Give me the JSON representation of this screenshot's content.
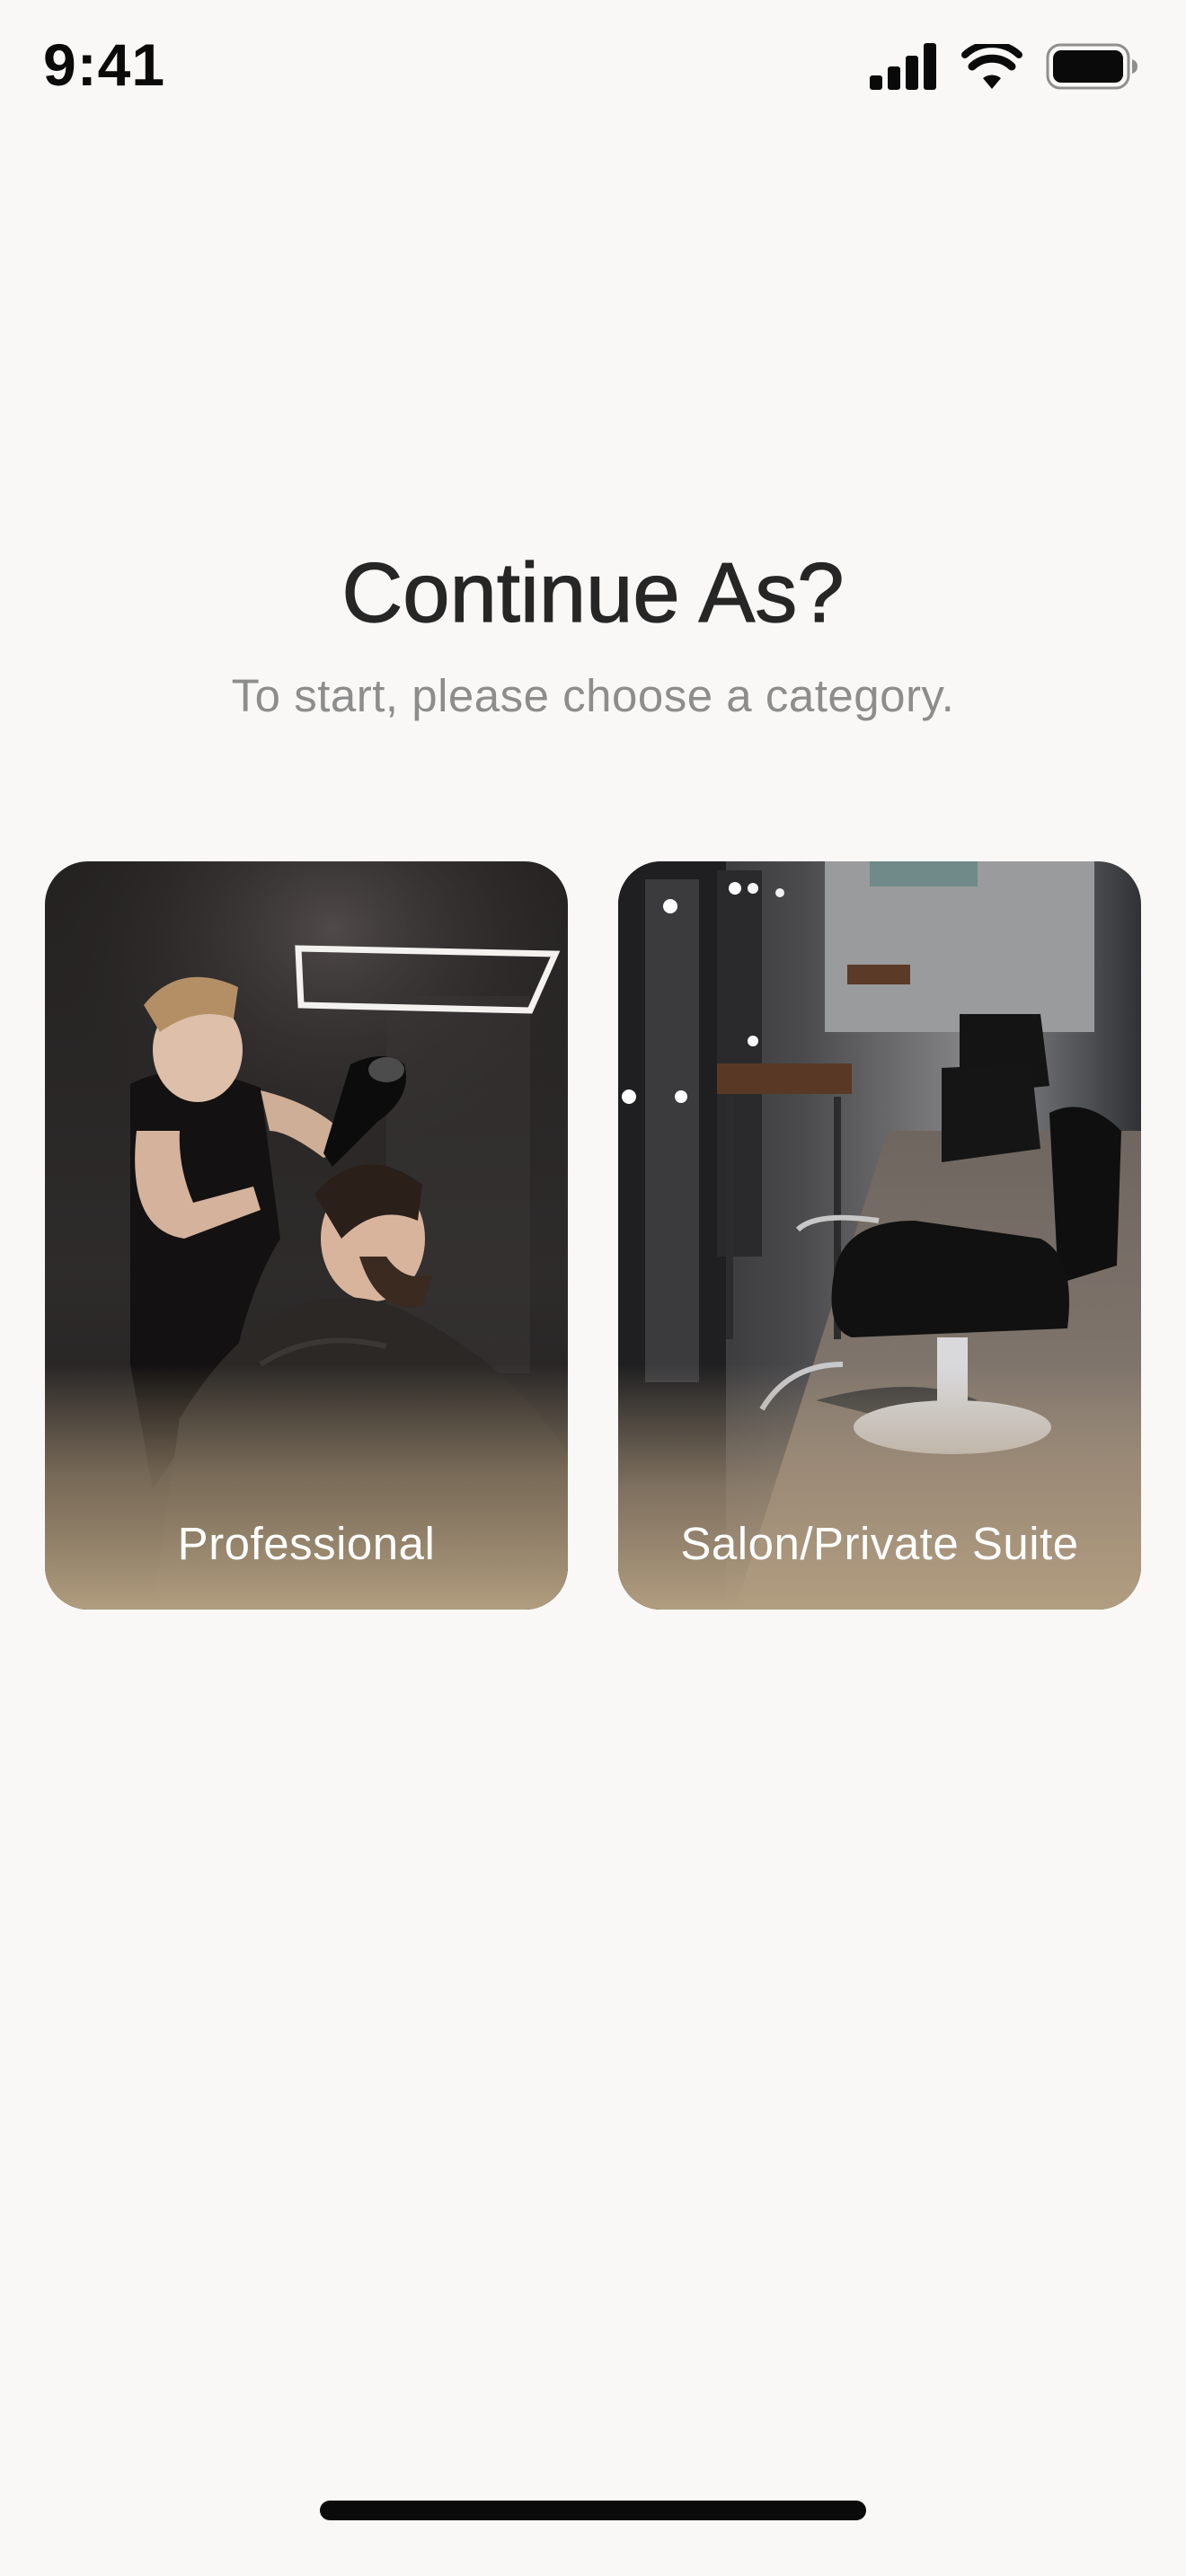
{
  "status_bar": {
    "time": "9:41",
    "icons": [
      "cellular-signal-icon",
      "wifi-icon",
      "battery-icon"
    ]
  },
  "onboarding": {
    "title": "Continue As?",
    "subtitle": "To start, please choose a category."
  },
  "categories": [
    {
      "label": "Professional",
      "image": "barber-styling-client-photo"
    },
    {
      "label": "Salon/Private Suite",
      "image": "salon-chairs-photo"
    }
  ],
  "colors": {
    "background": "#f9f8f7",
    "heading": "#262626",
    "subtitle": "#8d8d8d",
    "card_gradient_bottom": "#b19d7f",
    "card_label": "#ffffff"
  }
}
